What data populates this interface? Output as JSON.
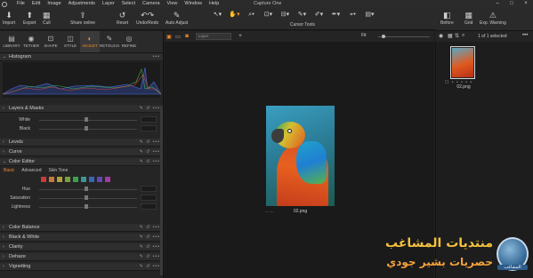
{
  "window": {
    "title": "Capture One",
    "menu": [
      "File",
      "Edit",
      "Image",
      "Adjustments",
      "Layer",
      "Select",
      "Camera",
      "View",
      "Window",
      "Help"
    ],
    "controls": [
      "–",
      "□",
      "×"
    ]
  },
  "toolbar": {
    "import": "Import",
    "export": "Export",
    "cull": "Cull",
    "share": "Share online",
    "reset": "Reset",
    "undo_redo": "Undo/Redo",
    "auto_adjust": "Auto Adjust",
    "cursor_tools": "Cursor Tools",
    "before": "Before",
    "grid": "Grid",
    "exp_warning": "Exp. Warning"
  },
  "tool_tabs": [
    {
      "label": "LIBRARY",
      "icon": "library-icon"
    },
    {
      "label": "TETHER",
      "icon": "camera-icon"
    },
    {
      "label": "SHAPE",
      "icon": "crop-icon"
    },
    {
      "label": "STYLE",
      "icon": "style-icon"
    },
    {
      "label": "ADJUST",
      "icon": "adjust-icon",
      "active": true
    },
    {
      "label": "RETOUCH",
      "icon": "retouch-icon"
    },
    {
      "label": "REFINE",
      "icon": "refine-icon"
    }
  ],
  "panel": {
    "histogram": "Histogram",
    "layers_masks": "Layers & Masks",
    "white": "White",
    "black": "Black",
    "levels": "Levels",
    "curve": "Curve",
    "color_editor": "Color Editor",
    "ce_tabs": [
      "Basic",
      "Advanced",
      "Skin Tone"
    ],
    "hue": "Hue",
    "saturation": "Saturation",
    "lightness": "Lightness",
    "color_balance": "Color Balance",
    "black_white": "Black & White",
    "clarity": "Clarity",
    "dehaze": "Dehaze",
    "vignetting": "Vignetting"
  },
  "swatch_colors": [
    "#c83c3c",
    "#c8783c",
    "#b4a03c",
    "#78a03c",
    "#3ca050",
    "#3c9696",
    "#3c64b4",
    "#6446b4",
    "#a03ca0"
  ],
  "viewer": {
    "layer_placeholder": "Layer",
    "fit": "Fit",
    "caption": "02.png",
    "caption_dots": "... ..."
  },
  "browser": {
    "count": "1 of 1 selected",
    "thumb_name": "02.png",
    "thumb_dots": "☐ • • • • •"
  },
  "watermark": {
    "line1": "منتديات المشاغب",
    "line2": "حصريات بشير جودي",
    "badge": "المشاغب"
  },
  "accent_color": "#f08c28"
}
